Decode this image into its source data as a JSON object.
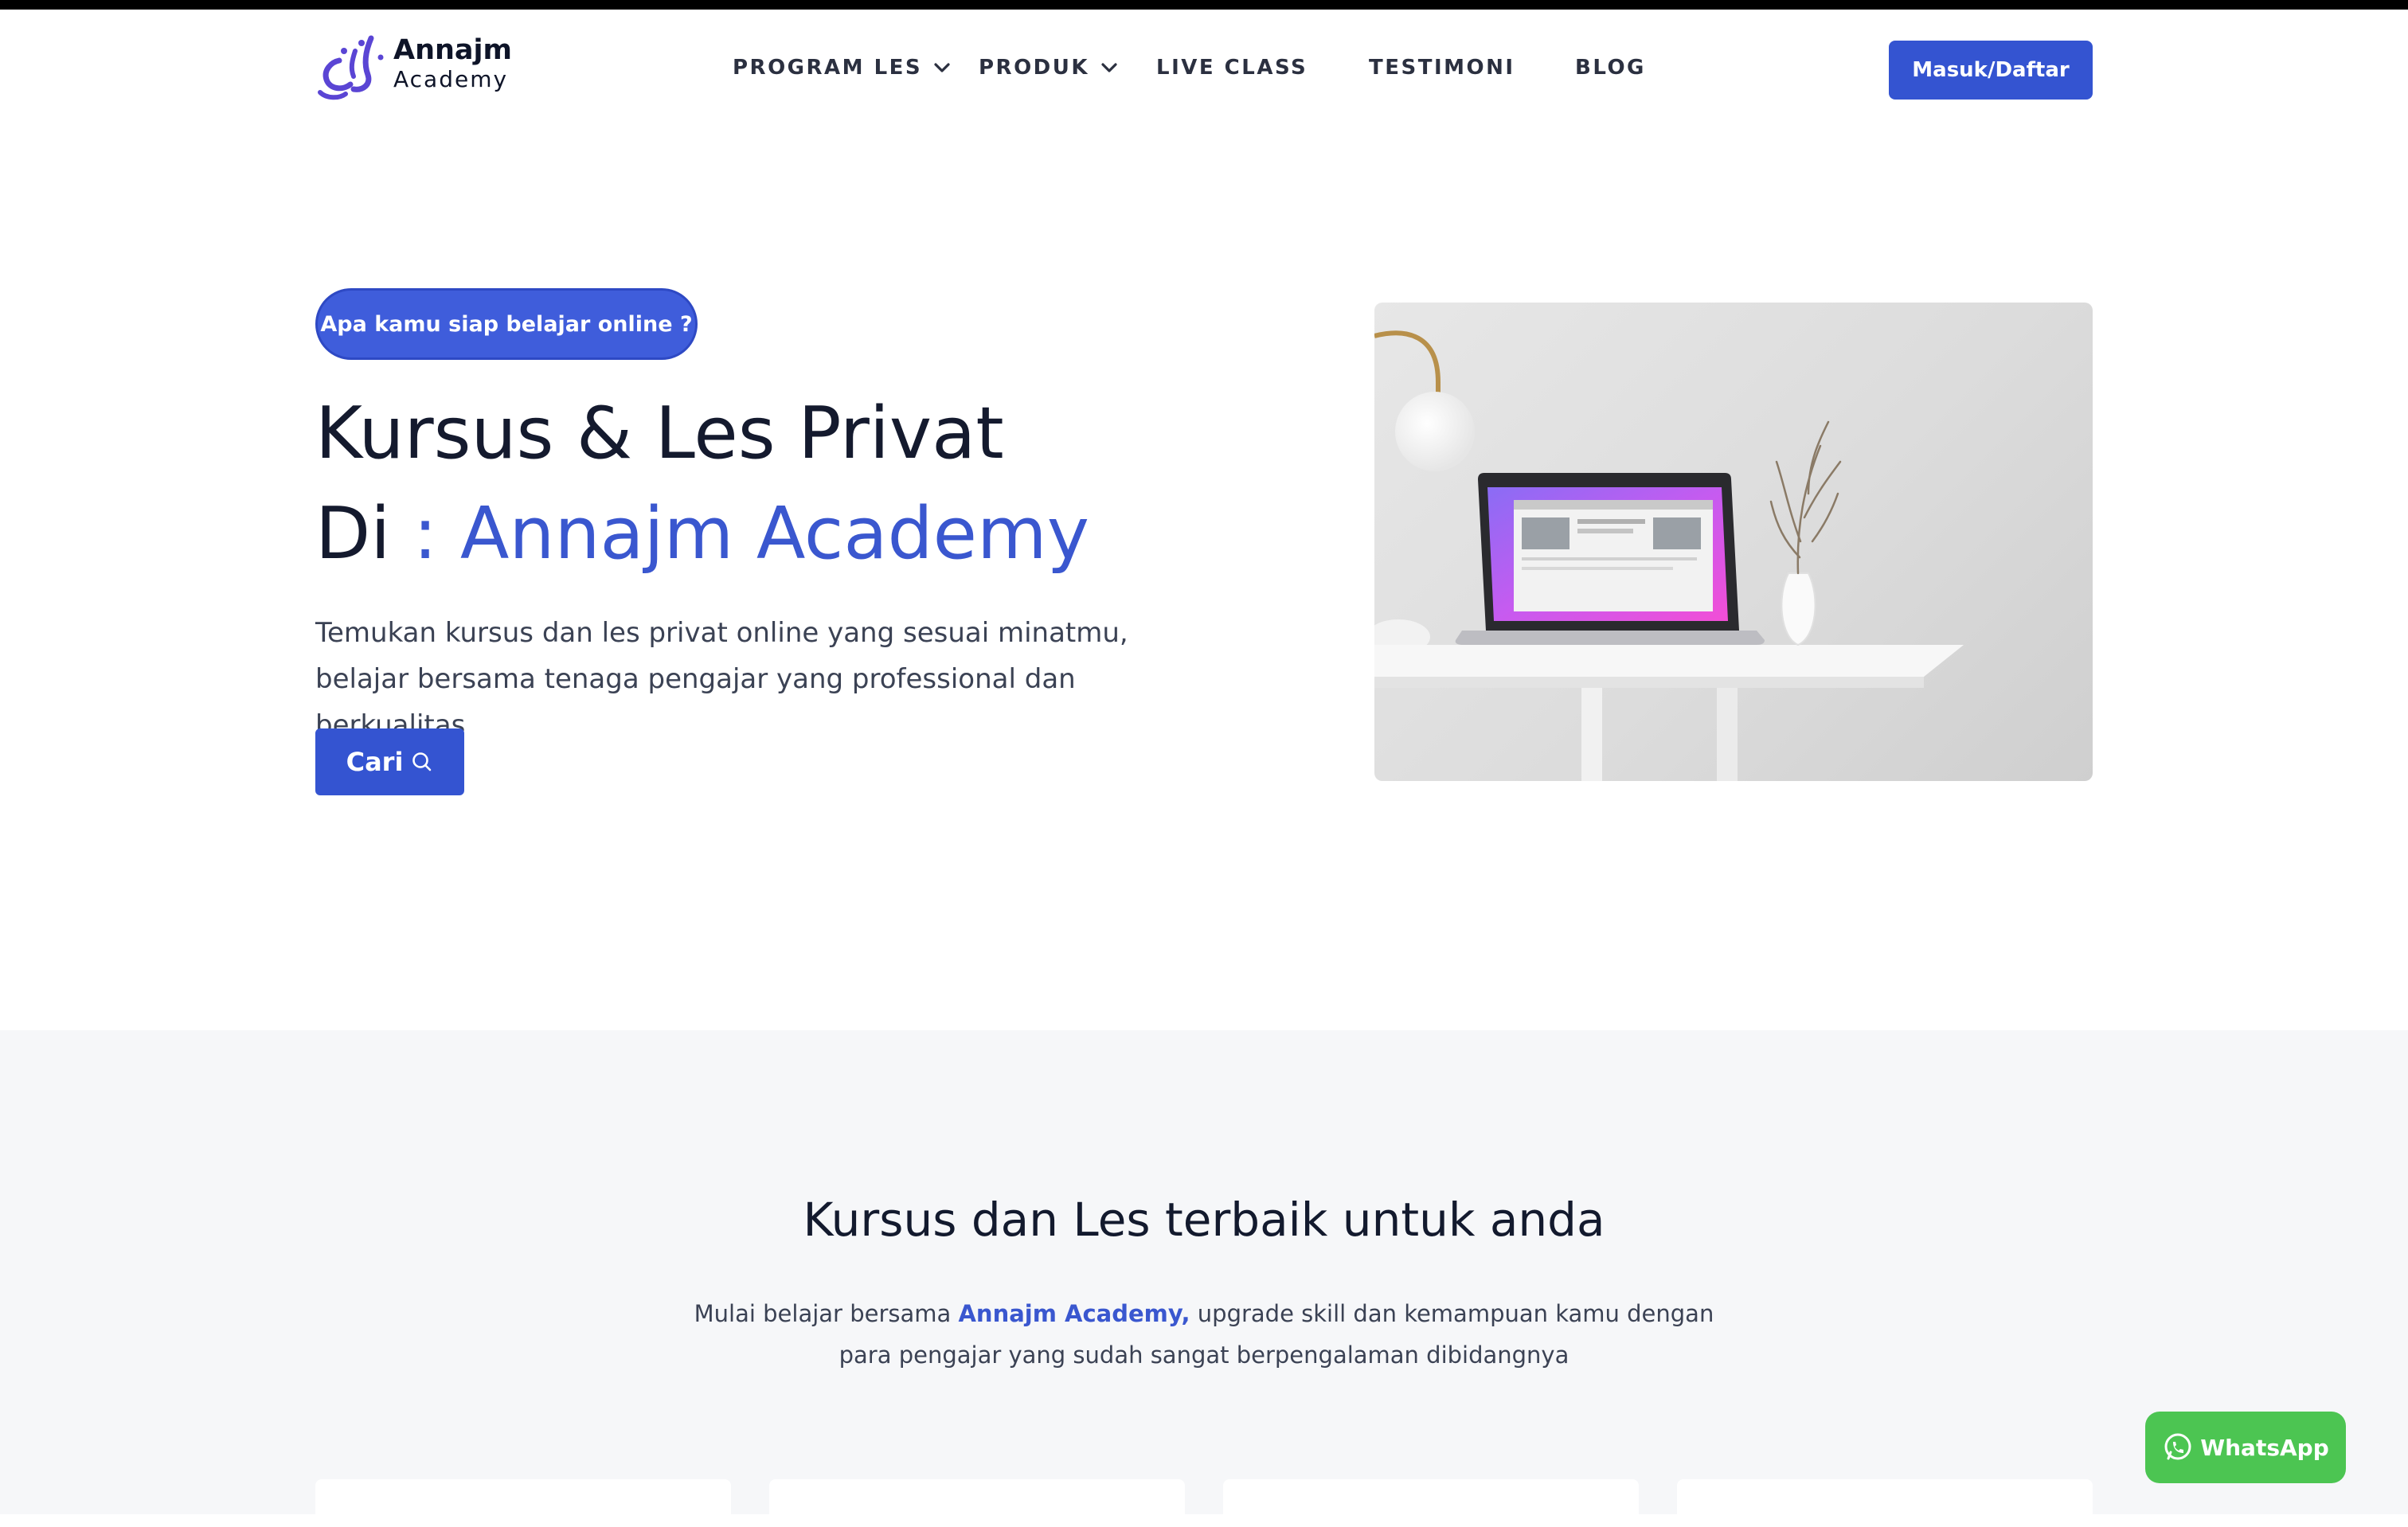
{
  "header": {
    "logo_name": "Annajm",
    "logo_sub": "Academy",
    "nav": [
      {
        "label": "PROGRAM LES"
      },
      {
        "label": "PRODUK"
      },
      {
        "label": "LIVE CLASS"
      },
      {
        "label": "TESTIMONI"
      },
      {
        "label": "BLOG"
      }
    ],
    "login_label": "Masuk/Daftar"
  },
  "hero": {
    "pill": "Apa kamu siap belajar online ?",
    "title_line1": "Kursus & Les Privat",
    "title_line2_prefix": "Di",
    "title_line2_accent": " : Annajm Academy",
    "description": "Temukan kursus dan les privat online yang sesuai minatmu, belajar bersama tenaga pengajar yang professional dan berkualitas",
    "search_label": "Cari"
  },
  "section": {
    "title": "Kursus dan Les terbaik untuk anda",
    "desc_prefix": "Mulai belajar bersama ",
    "desc_brand": "Annajm Academy,",
    "desc_suffix": " upgrade skill dan kemampuan kamu dengan para pengajar yang sudah sangat berpengalaman dibidangnya"
  },
  "whatsapp": {
    "label": "WhatsApp"
  },
  "colors": {
    "primary": "#3454d1",
    "accent_text": "#3a57cf",
    "whatsapp": "#4cc552",
    "section_bg": "#f6f7f9"
  }
}
